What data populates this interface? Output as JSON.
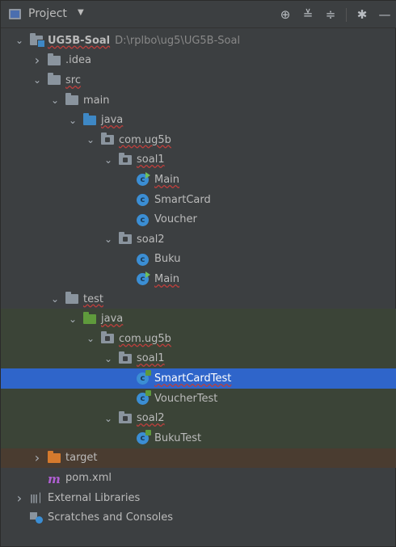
{
  "header": {
    "title": "Project",
    "caret": "▼",
    "tools": [
      {
        "icon": "crosshair-icon",
        "glyph": "⊕"
      },
      {
        "icon": "collapse-all-icon",
        "glyph": "≚"
      },
      {
        "icon": "expand-all-icon",
        "glyph": "≑"
      },
      {
        "icon": "gear-icon",
        "glyph": "✱"
      },
      {
        "icon": "hide-icon",
        "glyph": "—"
      }
    ]
  },
  "tree": [
    {
      "label": "UG5B-Soal",
      "sub": "D:\\rplbo\\ug5\\UG5B-Soal",
      "depth": 0,
      "arrow": "open",
      "icon": "module",
      "bold": true,
      "squig": true
    },
    {
      "label": ".idea",
      "depth": 1,
      "arrow": "closed",
      "icon": "folder"
    },
    {
      "label": "src",
      "depth": 1,
      "arrow": "open",
      "icon": "folder",
      "squig": true
    },
    {
      "label": "main",
      "depth": 2,
      "arrow": "open",
      "icon": "folder"
    },
    {
      "label": "java",
      "depth": 3,
      "arrow": "open",
      "icon": "folder-blue",
      "squig": true
    },
    {
      "label": "com.ug5b",
      "depth": 4,
      "arrow": "open",
      "icon": "package",
      "squig": true
    },
    {
      "label": "soal1",
      "depth": 5,
      "arrow": "open",
      "icon": "package",
      "squig": true
    },
    {
      "label": "Main",
      "depth": 6,
      "arrow": "none",
      "icon": "class-run",
      "squig": true
    },
    {
      "label": "SmartCard",
      "depth": 6,
      "arrow": "none",
      "icon": "class"
    },
    {
      "label": "Voucher",
      "depth": 6,
      "arrow": "none",
      "icon": "class"
    },
    {
      "label": "soal2",
      "depth": 5,
      "arrow": "open",
      "icon": "package"
    },
    {
      "label": "Buku",
      "depth": 6,
      "arrow": "none",
      "icon": "class"
    },
    {
      "label": "Main",
      "depth": 6,
      "arrow": "none",
      "icon": "class-run",
      "squig": true
    },
    {
      "label": "test",
      "depth": 2,
      "arrow": "open",
      "icon": "folder",
      "squig": true
    },
    {
      "label": "java",
      "depth": 3,
      "arrow": "open",
      "icon": "folder-green",
      "bg": "test",
      "squig": true
    },
    {
      "label": "com.ug5b",
      "depth": 4,
      "arrow": "open",
      "icon": "package",
      "bg": "test",
      "squig": true
    },
    {
      "label": "soal1",
      "depth": 5,
      "arrow": "open",
      "icon": "package",
      "bg": "test",
      "squig": true
    },
    {
      "label": "SmartCardTest",
      "depth": 6,
      "arrow": "none",
      "icon": "class-test",
      "selected": true,
      "squig": true
    },
    {
      "label": "VoucherTest",
      "depth": 6,
      "arrow": "none",
      "icon": "class-test",
      "bg": "test"
    },
    {
      "label": "soal2",
      "depth": 5,
      "arrow": "open",
      "icon": "package",
      "bg": "test",
      "squig": true
    },
    {
      "label": "BukuTest",
      "depth": 6,
      "arrow": "none",
      "icon": "class-test",
      "bg": "test"
    },
    {
      "label": "target",
      "depth": 1,
      "arrow": "closed",
      "icon": "folder-orange",
      "bg": "excl"
    },
    {
      "label": "pom.xml",
      "depth": 1,
      "arrow": "none",
      "icon": "maven"
    },
    {
      "label": "External Libraries",
      "depth": 0,
      "arrow": "closed",
      "icon": "libraries"
    },
    {
      "label": "Scratches and Consoles",
      "depth": 0,
      "arrow": "none",
      "icon": "scratches"
    }
  ]
}
